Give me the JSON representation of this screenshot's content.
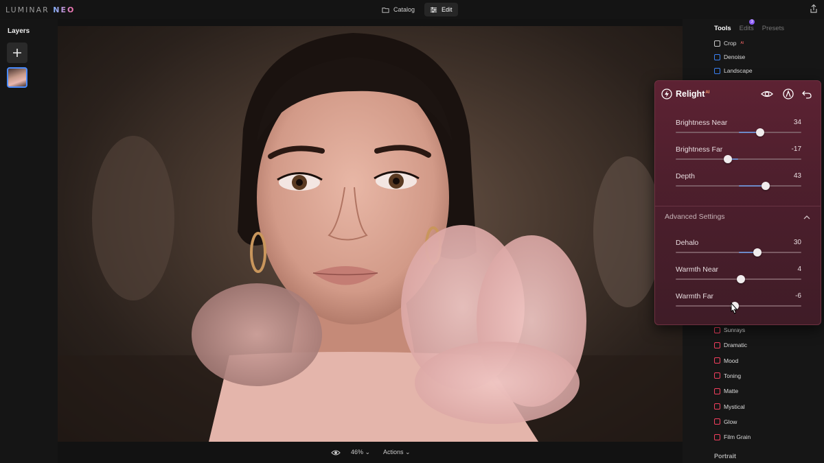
{
  "app": {
    "logo_main": "LUMINAR",
    "logo_accent": "NEO",
    "tabs": [
      {
        "label": "Catalog",
        "icon": "folder-icon",
        "active": false
      },
      {
        "label": "Edit",
        "icon": "sliders-icon",
        "active": true
      }
    ]
  },
  "layers": {
    "title": "Layers"
  },
  "bottom": {
    "zoom": "46% ⌄",
    "actions": "Actions ⌄"
  },
  "right_panel": {
    "tabs": [
      {
        "label": "Tools",
        "active": true
      },
      {
        "label": "Edits",
        "active": false
      },
      {
        "label": "Presets",
        "active": false
      }
    ],
    "edits_badge": "3",
    "top_tools": [
      {
        "label": "Crop",
        "ai": "AI",
        "color": "#cccccc"
      },
      {
        "label": "Denoise",
        "color": "#3b82f6"
      },
      {
        "label": "Landscape",
        "color": "#3b82f6"
      }
    ],
    "bottom_tools": [
      {
        "label": "Sunrays",
        "color": "#f43f5e"
      },
      {
        "label": "Dramatic",
        "color": "#f43f5e"
      },
      {
        "label": "Mood",
        "color": "#f43f5e"
      },
      {
        "label": "Toning",
        "color": "#f43f5e"
      },
      {
        "label": "Matte",
        "color": "#f43f5e"
      },
      {
        "label": "Mystical",
        "color": "#f43f5e"
      },
      {
        "label": "Glow",
        "color": "#f43f5e"
      },
      {
        "label": "Film Grain",
        "color": "#f43f5e"
      }
    ],
    "section_portrait": "Portrait"
  },
  "relight": {
    "title": "Relight",
    "ai": "AI",
    "sliders": [
      {
        "label": "Brightness Near",
        "value": "34",
        "num": 34
      },
      {
        "label": "Brightness Far",
        "value": "-17",
        "num": -17
      },
      {
        "label": "Depth",
        "value": "43",
        "num": 43
      }
    ],
    "advanced_label": "Advanced Settings",
    "advanced_sliders": [
      {
        "label": "Dehalo",
        "value": "30",
        "num": 30
      },
      {
        "label": "Warmth Near",
        "value": "4",
        "num": 4
      },
      {
        "label": "Warmth Far",
        "value": "-6",
        "num": -6
      }
    ]
  },
  "colors": {
    "accent_blue": "#4a8cff",
    "relight_bg": "#5d2233",
    "badge": "#8b5cf6"
  }
}
